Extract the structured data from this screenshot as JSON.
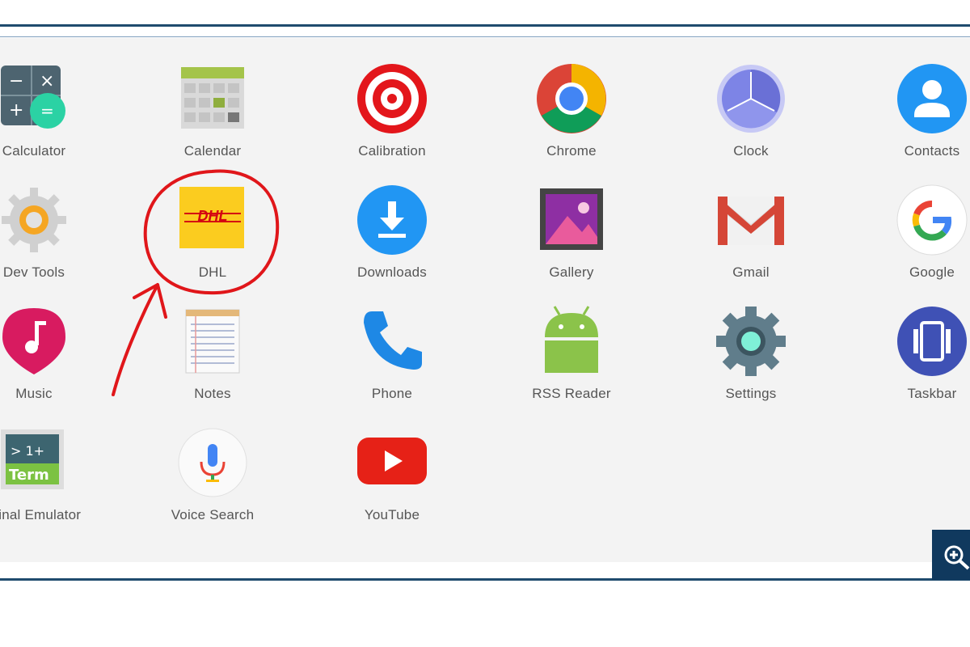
{
  "apps": [
    {
      "id": "calculator",
      "label": "Calculator",
      "icon": "calculator-icon"
    },
    {
      "id": "calendar",
      "label": "Calendar",
      "icon": "calendar-icon"
    },
    {
      "id": "calibration",
      "label": "Calibration",
      "icon": "target-icon"
    },
    {
      "id": "chrome",
      "label": "Chrome",
      "icon": "chrome-icon"
    },
    {
      "id": "clock",
      "label": "Clock",
      "icon": "clock-icon"
    },
    {
      "id": "contacts",
      "label": "Contacts",
      "icon": "person-icon"
    },
    {
      "id": "dev-tools",
      "label": "Dev Tools",
      "icon": "gear-icon"
    },
    {
      "id": "dhl",
      "label": "DHL",
      "icon": "dhl-icon",
      "icon_text": "DHL"
    },
    {
      "id": "downloads",
      "label": "Downloads",
      "icon": "download-icon"
    },
    {
      "id": "gallery",
      "label": "Gallery",
      "icon": "picture-icon"
    },
    {
      "id": "gmail",
      "label": "Gmail",
      "icon": "envelope-icon"
    },
    {
      "id": "google",
      "label": "Google",
      "icon": "google-g-icon"
    },
    {
      "id": "music",
      "label": "Music",
      "icon": "music-note-icon"
    },
    {
      "id": "notes",
      "label": "Notes",
      "icon": "notepad-icon"
    },
    {
      "id": "phone",
      "label": "Phone",
      "icon": "phone-icon"
    },
    {
      "id": "rss-reader",
      "label": "RSS Reader",
      "icon": "android-icon"
    },
    {
      "id": "settings",
      "label": "Settings",
      "icon": "settings-gear-icon"
    },
    {
      "id": "taskbar",
      "label": "Taskbar",
      "icon": "taskbar-icon"
    },
    {
      "id": "terminal-emulator",
      "label": "minal Emulator",
      "icon": "terminal-icon",
      "icon_text": "> 1+",
      "icon_text2": "Term"
    },
    {
      "id": "voice-search",
      "label": "Voice Search",
      "icon": "microphone-icon"
    },
    {
      "id": "youtube",
      "label": "YouTube",
      "icon": "play-icon"
    }
  ],
  "annotation": {
    "color": "#e0161a",
    "target": "dhl",
    "shape": "circle-with-arrow"
  },
  "zoom_button": {
    "icon": "zoom-in-icon",
    "color": "#10395e"
  },
  "colors": {
    "frame": "#1f4b6e",
    "drawer_bg": "#f3f3f3",
    "label": "#555555"
  }
}
